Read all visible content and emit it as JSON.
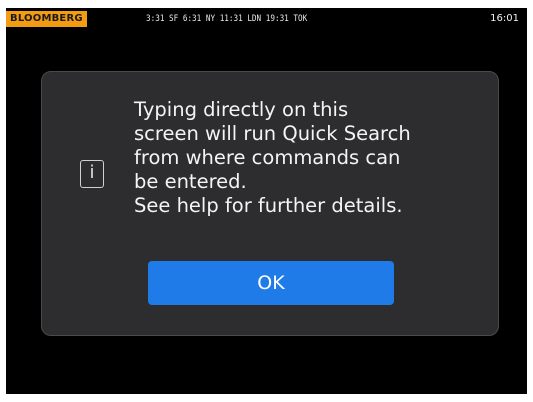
{
  "topbar": {
    "brand": "BLOOMBERG",
    "world_clocks": "3:31 SF   6:31 NY   11:31 LDN  19:31 TOK",
    "time": "16:01"
  },
  "dialog": {
    "icon": "info-icon",
    "message_lines": [
      "Typing directly on this",
      "screen will run Quick Search",
      "from where commands can",
      "be entered.",
      "See help for further details."
    ],
    "ok_label": "OK"
  },
  "colors": {
    "background": "#000000",
    "brand_bg": "#f39c12",
    "dialog_bg": "#2d2d2f",
    "button_bg": "#1f7be8"
  }
}
